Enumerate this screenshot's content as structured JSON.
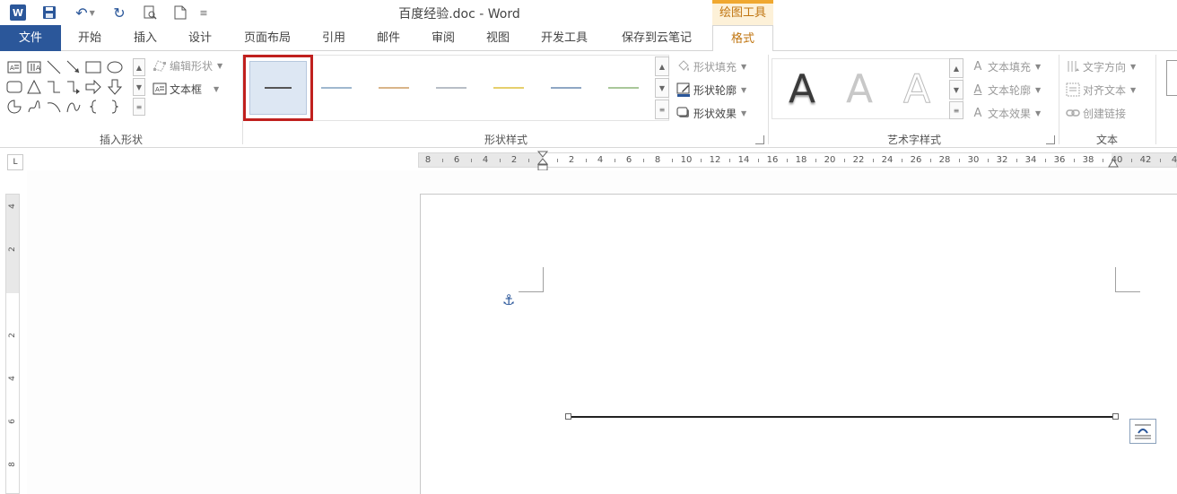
{
  "titlebar": {
    "doc_title": "百度经验.doc - Word",
    "contextual_group": "绘图工具",
    "word_logo": "W"
  },
  "tabs": [
    {
      "label": "文件"
    },
    {
      "label": "开始"
    },
    {
      "label": "插入"
    },
    {
      "label": "设计"
    },
    {
      "label": "页面布局"
    },
    {
      "label": "引用"
    },
    {
      "label": "邮件"
    },
    {
      "label": "审阅"
    },
    {
      "label": "视图"
    },
    {
      "label": "开发工具"
    },
    {
      "label": "保存到云笔记"
    },
    {
      "label": "格式"
    }
  ],
  "ribbon": {
    "insert_shapes": {
      "label": "插入形状",
      "edit_shape": "编辑形状",
      "text_box": "文本框"
    },
    "shape_styles": {
      "label": "形状样式",
      "fill": "形状填充",
      "outline": "形状轮廓",
      "effects": "形状效果",
      "swatch_colors": [
        "#555555",
        "#9fb8cf",
        "#d9b589",
        "#b8bec6",
        "#e6cf6d",
        "#8fa7c4",
        "#a9c79a"
      ]
    },
    "wordart_styles": {
      "label": "艺术字样式",
      "glyph": "A",
      "text_fill": "文本填充",
      "text_outline": "文本轮廓",
      "text_effects": "文本效果"
    },
    "text_group": {
      "label": "文本",
      "direction": "文字方向",
      "align": "对齐文本",
      "link": "创建链接"
    }
  },
  "ruler": {
    "h_ticks": [
      "8",
      "6",
      "4",
      "2",
      "",
      "2",
      "4",
      "6",
      "8",
      "10",
      "12",
      "14",
      "16",
      "18",
      "20",
      "22",
      "24",
      "26",
      "28",
      "30",
      "32",
      "34",
      "36",
      "38",
      "40",
      "42",
      "4"
    ],
    "v_ticks": [
      "4",
      "2",
      "",
      "2",
      "4",
      "6",
      "8"
    ],
    "corner": "L"
  },
  "colors": {
    "accent": "#2b579a",
    "contextual": "#c07510",
    "selection_border": "#c0201e"
  }
}
